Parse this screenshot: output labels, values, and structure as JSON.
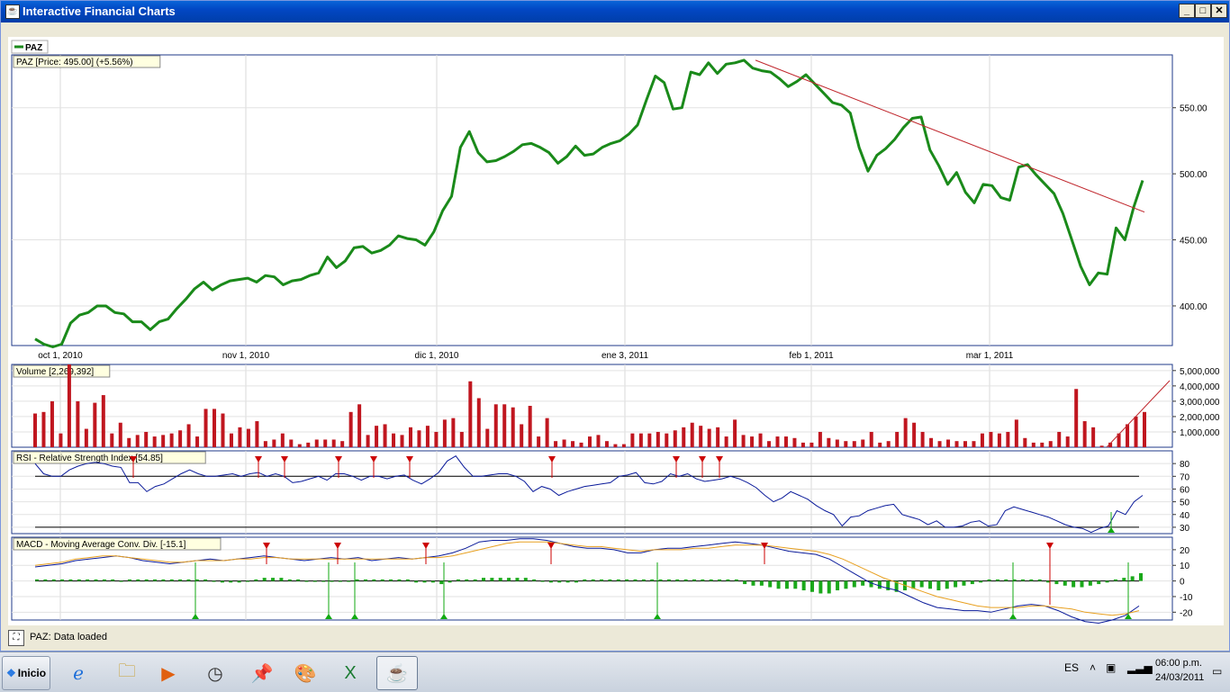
{
  "window": {
    "title": "Interactive Financial Charts"
  },
  "legend": {
    "symbol": "PAZ",
    "color": "#1a8a1a"
  },
  "panels": {
    "price": {
      "label": "PAZ [Price: 495.00] (+5.56%)",
      "yticks": [
        "550.00",
        "500.00",
        "450.00",
        "400.00"
      ]
    },
    "volume": {
      "label": "Volume [2,269,392]",
      "yticks": [
        "5,000,000",
        "4,000,000",
        "3,000,000",
        "2,000,000",
        "1,000,000"
      ]
    },
    "rsi": {
      "label": "RSI - Relative Strength Index [54.85]",
      "yticks": [
        "80",
        "70",
        "60",
        "50",
        "40",
        "30"
      ]
    },
    "macd": {
      "label": "MACD - Moving Average Conv. Div. [-15.1]",
      "yticks": [
        "20",
        "10",
        "0",
        "-10",
        "-20"
      ]
    }
  },
  "xaxis": {
    "labels": [
      "oct 1, 2010",
      "nov 1, 2010",
      "dic 1, 2010",
      "ene 3, 2011",
      "feb 1, 2011",
      "mar 1, 2011"
    ]
  },
  "status": {
    "text": "PAZ: Data loaded"
  },
  "taskbar": {
    "start_label": "Inicio",
    "language": "ES",
    "time": "06:00 p.m.",
    "date": "24/03/2011"
  },
  "colors": {
    "price_line": "#1a8a1a",
    "trendline": "#c0272d",
    "volume_bar": "#c0161f",
    "rsi_line": "#0a1a9a",
    "macd_line": "#0a1a9a",
    "signal_line": "#e8a020",
    "histogram": "#1aa81a"
  },
  "chart_data": [
    {
      "type": "line",
      "series": [
        {
          "name": "PAZ",
          "values": [
            375,
            371,
            369,
            371,
            387,
            393,
            395,
            400,
            400,
            395,
            394,
            388,
            388,
            382,
            388,
            390,
            398,
            405,
            413,
            418,
            412,
            416,
            419,
            420,
            421,
            418,
            423,
            422,
            416,
            419,
            420,
            423,
            425,
            437,
            429,
            434,
            444,
            445,
            440,
            442,
            446,
            453,
            451,
            450,
            446,
            456,
            472,
            483,
            520,
            532,
            516,
            509,
            510,
            513,
            517,
            522,
            523,
            520,
            516,
            508,
            513,
            521,
            514,
            515,
            520,
            523,
            525,
            530,
            537,
            556,
            574,
            569,
            549,
            550,
            577,
            575,
            584,
            576,
            583,
            584,
            586,
            580,
            578,
            577,
            572,
            566,
            570,
            575,
            568,
            561,
            554,
            552,
            546,
            520,
            502,
            514,
            519,
            526,
            535,
            542,
            543,
            518,
            506,
            492,
            501,
            486,
            478,
            492,
            491,
            482,
            480,
            505,
            507,
            499,
            492,
            485,
            470,
            450,
            430,
            416,
            425,
            424,
            459,
            450,
            475,
            495
          ]
        }
      ],
      "ylim": [
        370,
        590
      ]
    },
    {
      "type": "bar",
      "series": [
        {
          "name": "Volume",
          "values": [
            2200000,
            2300000,
            3000000,
            900000,
            5400000,
            3000000,
            1200000,
            2900000,
            3400000,
            900000,
            1600000,
            600000,
            800000,
            1000000,
            700000,
            800000,
            900000,
            1100000,
            1500000,
            700000,
            2500000,
            2500000,
            2200000,
            900000,
            1300000,
            1200000,
            1700000,
            400000,
            500000,
            900000,
            500000,
            200000,
            300000,
            500000,
            500000,
            500000,
            400000,
            2300000,
            2800000,
            800000,
            1400000,
            1500000,
            900000,
            800000,
            1300000,
            1100000,
            1400000,
            1000000,
            1800000,
            1900000,
            1000000,
            4300000,
            3200000,
            1200000,
            2800000,
            2800000,
            2600000,
            1500000,
            2700000,
            700000,
            1900000,
            400000,
            500000,
            400000,
            300000,
            700000,
            800000,
            400000,
            200000,
            200000,
            900000,
            900000,
            900000,
            1000000,
            900000,
            1100000,
            1300000,
            1600000,
            1400000,
            1200000,
            1300000,
            700000,
            1800000,
            800000,
            700000,
            900000,
            400000,
            700000,
            700000,
            600000,
            300000,
            300000,
            1000000,
            600000,
            500000,
            400000,
            400000,
            500000,
            1000000,
            300000,
            400000,
            1000000,
            1900000,
            1600000,
            1000000,
            600000,
            400000,
            500000,
            400000,
            400000,
            400000,
            900000,
            1000000,
            900000,
            1000000,
            1800000,
            600000,
            300000,
            300000,
            400000,
            1000000,
            700000,
            3800000,
            1700000,
            1300000,
            100000,
            300000,
            900000,
            1500000,
            2000000,
            2300000
          ]
        }
      ],
      "ylim": [
        0,
        5400000
      ]
    },
    {
      "type": "line",
      "series": [
        {
          "name": "RSI",
          "values": [
            80,
            72,
            70,
            70,
            75,
            78,
            80,
            81,
            80,
            78,
            77,
            65,
            65,
            58,
            62,
            64,
            68,
            72,
            75,
            72,
            70,
            70,
            71,
            72,
            70,
            72,
            73,
            70,
            72,
            70,
            65,
            66,
            68,
            70,
            67,
            72,
            72,
            70,
            67,
            70,
            70,
            68,
            70,
            71,
            67,
            64,
            68,
            73,
            82,
            86,
            77,
            70,
            70,
            71,
            72,
            72,
            70,
            66,
            58,
            62,
            60,
            55,
            58,
            60,
            62,
            63,
            64,
            65,
            70,
            71,
            73,
            65,
            64,
            66,
            72,
            70,
            72,
            68,
            66,
            67,
            68,
            70,
            68,
            65,
            61,
            55,
            50,
            53,
            58,
            55,
            52,
            47,
            43,
            40,
            31,
            38,
            39,
            43,
            45,
            47,
            48,
            40,
            38,
            36,
            32,
            35,
            30,
            30,
            31,
            34,
            35,
            31,
            32,
            43,
            46,
            44,
            42,
            40,
            38,
            35,
            32,
            30,
            29,
            26,
            29,
            31,
            43,
            40,
            50,
            55
          ]
        }
      ],
      "ylim": [
        25,
        90
      ],
      "levels": [
        70,
        30
      ]
    },
    {
      "type": "line",
      "series": [
        {
          "name": "MACD",
          "values": [
            9,
            10,
            11,
            13,
            14,
            15,
            16,
            15,
            13,
            12,
            11,
            12,
            13,
            14,
            13,
            14,
            15,
            16,
            15,
            14,
            13,
            14,
            15,
            14,
            15,
            13,
            14,
            15,
            14,
            15,
            16,
            18,
            21,
            25,
            26,
            26,
            27,
            27,
            26,
            24,
            22,
            21,
            21,
            20,
            18,
            18,
            20,
            21,
            21,
            22,
            23,
            24,
            25,
            24,
            23,
            21,
            19,
            18,
            17,
            14,
            9,
            4,
            -1,
            -4,
            -6,
            -10,
            -14,
            -17,
            -18,
            -19,
            -19,
            -20,
            -18,
            -16,
            -15,
            -16,
            -19,
            -23,
            -26,
            -27,
            -25,
            -22,
            -16
          ]
        },
        {
          "name": "Signal",
          "values": [
            10,
            11,
            12,
            14,
            15,
            16,
            16,
            15,
            14,
            13,
            12,
            12,
            13,
            13,
            13,
            14,
            14,
            15,
            15,
            14,
            14,
            14,
            14,
            14,
            14,
            14,
            14,
            14,
            14,
            15,
            15,
            16,
            18,
            20,
            22,
            24,
            25,
            25,
            25,
            24,
            23,
            22,
            22,
            21,
            20,
            19,
            20,
            20,
            20,
            21,
            21,
            22,
            23,
            23,
            23,
            22,
            21,
            20,
            19,
            17,
            14,
            10,
            6,
            2,
            -1,
            -4,
            -7,
            -10,
            -12,
            -14,
            -16,
            -17,
            -17,
            -17,
            -16,
            -16,
            -17,
            -18,
            -20,
            -21,
            -22,
            -21,
            -19
          ]
        }
      ],
      "histogram": [
        1,
        1,
        1,
        1,
        1,
        1,
        1,
        1,
        1,
        1,
        0,
        1,
        1,
        1,
        1,
        1,
        1,
        1,
        1,
        1,
        1,
        0,
        -1,
        -1,
        -1,
        0,
        1,
        2,
        2,
        2,
        1,
        1,
        0,
        0,
        0,
        0,
        0,
        0,
        1,
        1,
        1,
        1,
        1,
        1,
        1,
        -1,
        -1,
        -1,
        -2,
        -1,
        1,
        1,
        1,
        2,
        2,
        2,
        2,
        2,
        2,
        1,
        0,
        -1,
        -1,
        -1,
        -1,
        1,
        1,
        1,
        1,
        1,
        1,
        1,
        1,
        1,
        1,
        1,
        1,
        1,
        1,
        1,
        1,
        1,
        1,
        1,
        -2,
        -3,
        -3,
        -4,
        -5,
        -5,
        -5,
        -6,
        -7,
        -8,
        -8,
        -6,
        -5,
        -4,
        -3,
        -4,
        -5,
        -6,
        -7,
        -6,
        -5,
        -4,
        -5,
        -6,
        -5,
        -4,
        -3,
        -2,
        -1,
        1,
        1,
        1,
        1,
        1,
        1,
        1,
        -1,
        -2,
        -3,
        -4,
        -4,
        -3,
        -2,
        -1,
        1,
        2,
        3,
        5
      ],
      "ylim": [
        -25,
        28
      ]
    }
  ]
}
